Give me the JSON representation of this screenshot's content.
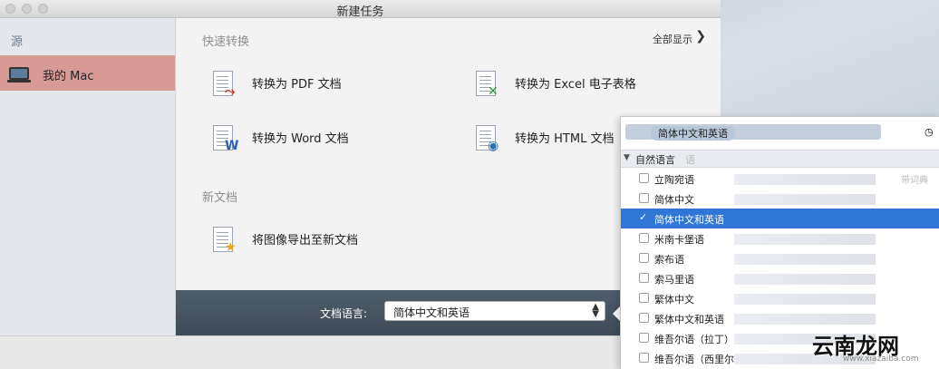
{
  "window": {
    "title": "新建任务"
  },
  "sidebar": {
    "header": "源",
    "items": [
      {
        "label": "我的 Mac",
        "icon": "laptop-icon",
        "selected": true
      }
    ]
  },
  "quick_convert": {
    "title": "快速转换",
    "show_all": "全部显示",
    "actions": [
      {
        "label": "转换为 PDF 文档",
        "icon": "pdf-doc-icon"
      },
      {
        "label": "转换为 Excel 电子表格",
        "icon": "excel-doc-icon"
      },
      {
        "label": "转换为 Word 文档",
        "icon": "word-doc-icon"
      },
      {
        "label": "转换为 HTML 文档",
        "icon": "html-doc-icon"
      }
    ]
  },
  "new_doc": {
    "title": "新文档",
    "actions": [
      {
        "label": "将图像导出至新文档",
        "icon": "image-export-icon"
      }
    ]
  },
  "bottom": {
    "label": "文档语言:",
    "select_value": "简体中文和英语"
  },
  "language_popover": {
    "search_chip": "简体中文和英语",
    "group": "自然语言",
    "group_overlay": "语",
    "dictionary_hint": "带词典",
    "languages": [
      {
        "label": "立陶宛语",
        "checked": false
      },
      {
        "label": "简体中文",
        "checked": false
      },
      {
        "label": "简体中文和英语",
        "checked": true
      },
      {
        "label": "米南卡堡语",
        "checked": false
      },
      {
        "label": "索布语",
        "checked": false
      },
      {
        "label": "索马里语",
        "checked": false
      },
      {
        "label": "繁体中文",
        "checked": false
      },
      {
        "label": "繁体中文和英语",
        "checked": false
      },
      {
        "label": "维吾尔语（拉丁）",
        "checked": false
      },
      {
        "label": "维吾尔语（西里尔）",
        "checked": false
      }
    ],
    "check_mark": "✓"
  },
  "watermark": {
    "main": "云南龙网",
    "sub": "www.xiazaiba.com"
  },
  "colors": {
    "sidebar_selected": "#d89a95",
    "bottom_bar": "#4a5866",
    "selection": "#2f76d7"
  }
}
